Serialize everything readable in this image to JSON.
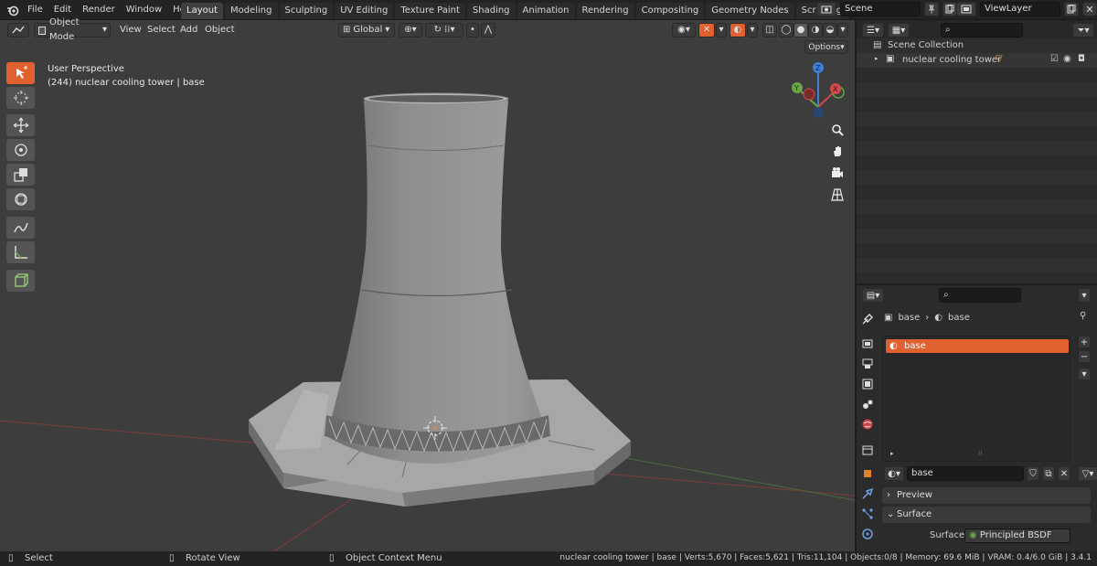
{
  "menu": {
    "file": "File",
    "edit": "Edit",
    "render": "Render",
    "window": "Window",
    "help": "Help"
  },
  "workspaces": [
    "Layout",
    "Modeling",
    "Sculpting",
    "UV Editing",
    "Texture Paint",
    "Shading",
    "Animation",
    "Rendering",
    "Compositing",
    "Geometry Nodes",
    "Scripting"
  ],
  "active_workspace": "Layout",
  "scene": {
    "name": "Scene"
  },
  "view_layer": {
    "name": "ViewLayer"
  },
  "viewport": {
    "mode": "Object Mode",
    "menu_view": "View",
    "menu_select": "Select",
    "menu_add": "Add",
    "menu_object": "Object",
    "transform_orientation": "Global",
    "options_label": "Options",
    "overlay_line1": "User Perspective",
    "overlay_line2": "(244) nuclear cooling tower | base",
    "gizmo": {
      "x": "X",
      "y": "Y",
      "z": "Z"
    }
  },
  "outliner": {
    "root": "Scene Collection",
    "item": "nuclear cooling tower"
  },
  "properties": {
    "breadcrumb_object": "base",
    "breadcrumb_material": "base",
    "slot_name": "base",
    "material_name": "base",
    "panel_preview": "Preview",
    "panel_surface": "Surface",
    "surface_label": "Surface",
    "surface_value": "Principled BSDF"
  },
  "statusbar": {
    "select": "Select",
    "rotate": "Rotate View",
    "context": "Object Context Menu",
    "stats": "nuclear cooling tower | base | Verts:5,670 | Faces:5,621 | Tris:11,104 | Objects:0/8 | Memory: 69.6 MiB | VRAM: 0.4/6.0 GiB | 3.4.1"
  },
  "colors": {
    "accent": "#e0612f",
    "axis_x": "#d04a4a",
    "axis_y": "#6aa646",
    "axis_z": "#3f7fd6",
    "viewport_bg": "#3d3d3d"
  }
}
